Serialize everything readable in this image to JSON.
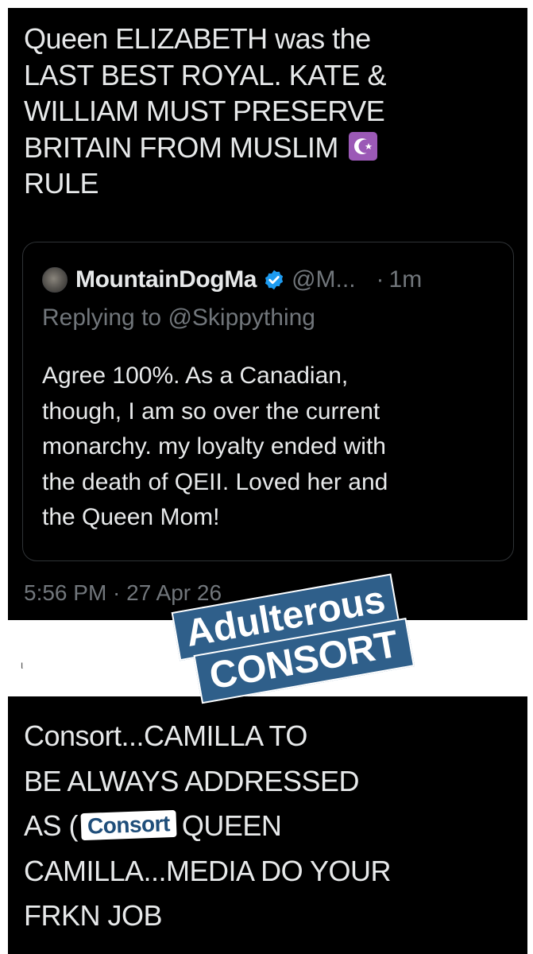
{
  "top_tweet": {
    "lines": [
      "Queen ELIZABETH was the",
      "LAST BEST ROYAL. KATE &",
      "WILLIAM MUST PRESERVE",
      "BRITAIN FROM MUSLIM",
      "RULE"
    ],
    "emoji_icon": "star-and-crescent-icon",
    "timestamp": "5:56 PM · 27 Apr 26"
  },
  "quoted_tweet": {
    "display_name": "MountainDogMa",
    "handle": "@M...",
    "dot": "·",
    "time": "1m",
    "replying_prefix": "Replying to",
    "replying_to": "@Skippything",
    "body_lines": [
      "Agree 100%.  As a Canadian,",
      "though, I am so over the current",
      "monarchy. my loyalty ended with",
      "the death of QEII. Loved her and",
      "the Queen Mom!"
    ]
  },
  "divider": {
    "mark": "ι"
  },
  "sticker": {
    "line1": "Adulterous",
    "line2": "CONSORT"
  },
  "bottom_tweet": {
    "line1": "Consort...CAMILLA TO",
    "line2": "BE ALWAYS ADDRESSED",
    "line3_prefix": "AS (",
    "line3_sticker": "Consort",
    "line3_suffix": "QUEEN",
    "line4": "CAMILLA...MEDIA DO YOUR",
    "line5": "FRKN JOB"
  },
  "colors": {
    "background": "#000000",
    "text": "#e7e9ea",
    "muted": "#71767b",
    "verified": "#1d9bf0",
    "sticker_blue": "#2f5f8a",
    "emoji_purple": "#9b59b6"
  }
}
